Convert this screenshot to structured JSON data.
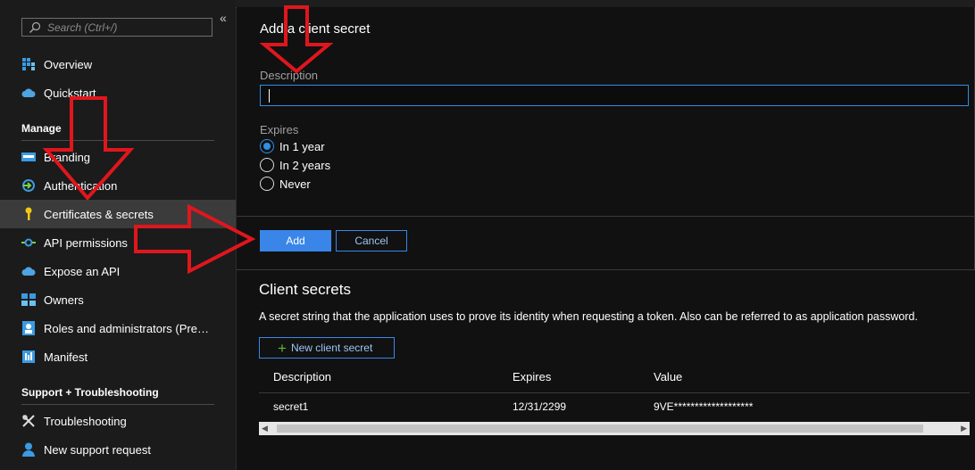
{
  "sidebar": {
    "search_placeholder": "Search (Ctrl+/)",
    "collapse_glyph": "«",
    "top_items": [
      {
        "label": "Overview",
        "icon": "overview-icon"
      },
      {
        "label": "Quickstart",
        "icon": "cloud-icon"
      }
    ],
    "manage_header": "Manage",
    "manage_items": [
      {
        "label": "Branding",
        "icon": "branding-icon"
      },
      {
        "label": "Authentication",
        "icon": "authentication-icon"
      },
      {
        "label": "Certificates & secrets",
        "icon": "key-icon",
        "selected": true
      },
      {
        "label": "API permissions",
        "icon": "api-permissions-icon"
      },
      {
        "label": "Expose an API",
        "icon": "cloud-icon"
      },
      {
        "label": "Owners",
        "icon": "owners-icon"
      },
      {
        "label": "Roles and administrators (Previ...",
        "icon": "roles-icon"
      },
      {
        "label": "Manifest",
        "icon": "manifest-icon"
      }
    ],
    "support_header": "Support + Troubleshooting",
    "support_items": [
      {
        "label": "Troubleshooting",
        "icon": "wrench-icon"
      },
      {
        "label": "New support request",
        "icon": "support-person-icon"
      }
    ]
  },
  "panel": {
    "title": "Add a client secret",
    "description_label": "Description",
    "description_value": "",
    "expires_label": "Expires",
    "expires_options": [
      "In 1 year",
      "In 2 years",
      "Never"
    ],
    "expires_selected": "In 1 year",
    "add_label": "Add",
    "cancel_label": "Cancel"
  },
  "client_secrets": {
    "title": "Client secrets",
    "description": "A secret string that the application uses to prove its identity when requesting a token. Also can be referred to as application password.",
    "new_button_label": "New client secret",
    "columns": [
      "Description",
      "Expires",
      "Value"
    ],
    "rows": [
      {
        "description": "secret1",
        "expires": "12/31/2299",
        "value": "9VE*******************"
      }
    ]
  },
  "colors": {
    "accent": "#3a86e8",
    "annotation_arrow": "#e0161d",
    "selected_nav_bg": "#3b3b3b"
  }
}
